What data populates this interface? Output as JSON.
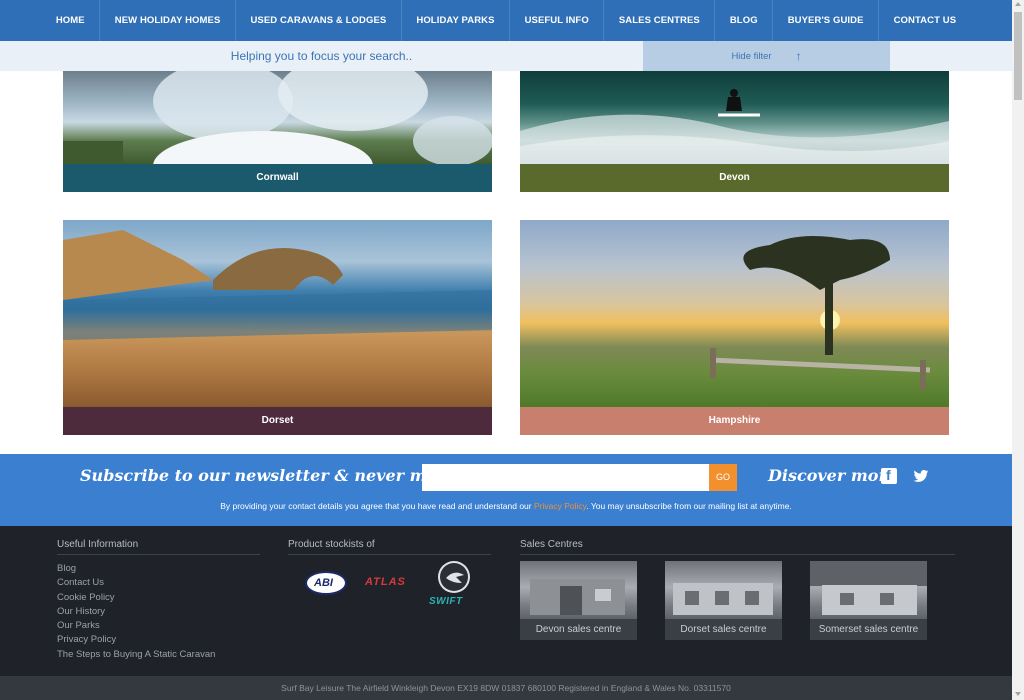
{
  "nav": {
    "items": [
      "HOME",
      "NEW HOLIDAY HOMES",
      "USED CARAVANS & LODGES",
      "HOLIDAY PARKS",
      "USEFUL INFO",
      "SALES CENTRES",
      "BLOG",
      "BUYER'S GUIDE",
      "CONTACT US"
    ]
  },
  "filter": {
    "helper_text": "Helping you to focus your search..",
    "hide_label": "Hide filter",
    "hide_icon": "up-arrow-icon"
  },
  "regions": [
    {
      "name": "Cornwall",
      "color": "#1b5a6d"
    },
    {
      "name": "Devon",
      "color": "#5a6a2c"
    },
    {
      "name": "Dorset",
      "color": "#4e2a3d"
    },
    {
      "name": "Hampshire",
      "color": "#c97f6e"
    }
  ],
  "newsletter": {
    "title": "Subscribe to our newsletter & never miss a thing",
    "email_placeholder": "",
    "go_label": "GO",
    "discover": "Discover more",
    "disclaimer_before": "By providing your contact details you agree that you have read and understand our ",
    "privacy_link": "Privacy Policy",
    "disclaimer_after": ". You may unsubscribe from our mailing list at anytime."
  },
  "footer": {
    "useful_heading": "Useful Information",
    "useful_links": [
      "Blog",
      "Contact Us",
      "Cookie Policy",
      "Our History",
      "Our Parks",
      "Privacy Policy",
      "The Steps to Buying A Static Caravan"
    ],
    "stockists_heading": "Product stockists of",
    "brands": [
      "ABI",
      "ATLAS",
      "SWIFT"
    ],
    "sales_heading": "Sales Centres",
    "sales_centres": [
      "Devon sales centre",
      "Dorset sales centre",
      "Somerset sales centre"
    ],
    "legal": "Surf Bay Leisure The Airfield Winkleigh Devon EX19 8DW 01837 680100 Registered in England & Wales No. 03311570"
  },
  "colors": {
    "nav_bg": "#2f6fb7",
    "accent_orange": "#f2902e",
    "newsletter_bg": "#3b7fd1",
    "footer_bg": "#1f2329"
  }
}
